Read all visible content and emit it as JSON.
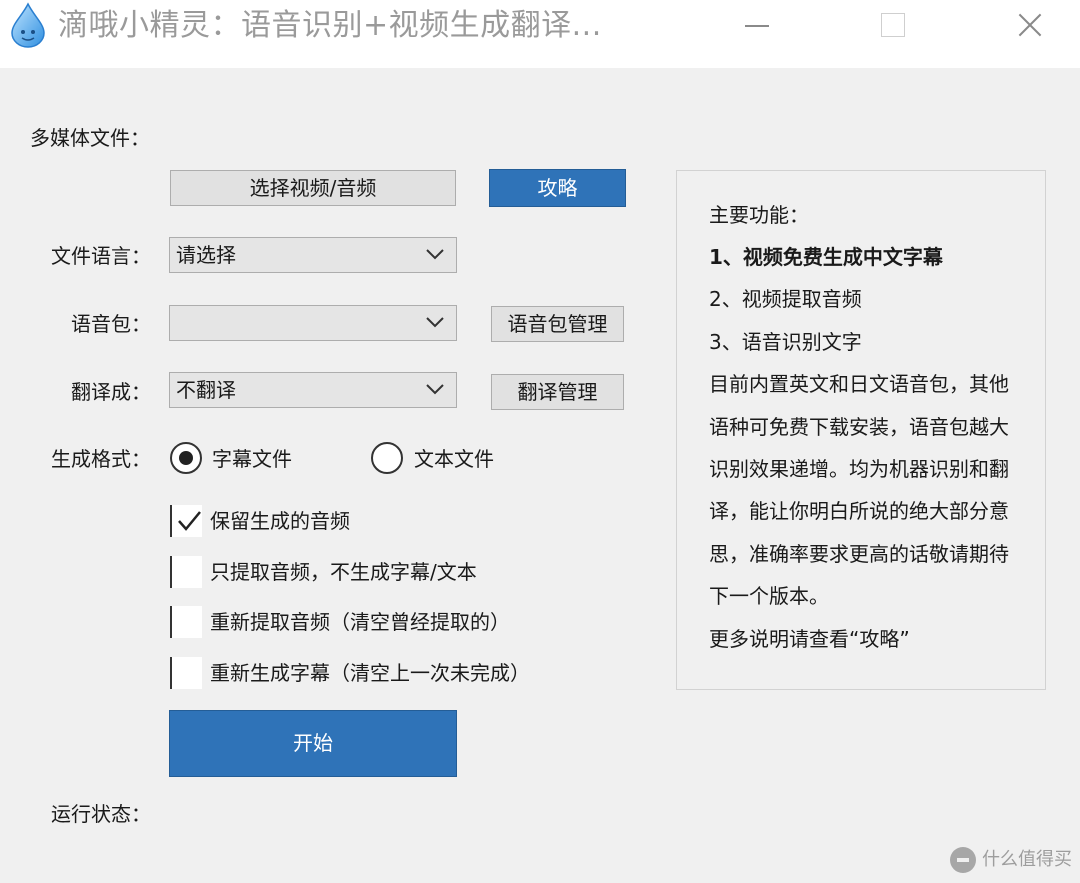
{
  "window": {
    "title": "滴哦小精灵：语音识别+视频生成翻译..."
  },
  "form": {
    "media_label": "多媒体文件：",
    "select_media_button": "选择视频/音频",
    "guide_button": "攻略",
    "file_language_label": "文件语言：",
    "file_language_value": "请选择",
    "voice_pack_label": "语音包：",
    "voice_pack_value": "",
    "voice_pack_manage_button": "语音包管理",
    "translate_label": "翻译成：",
    "translate_value": "不翻译",
    "translate_manage_button": "翻译管理",
    "format_label": "生成格式：",
    "format_options": [
      {
        "label": "字幕文件",
        "selected": true
      },
      {
        "label": "文本文件",
        "selected": false
      }
    ],
    "options": [
      {
        "label": "保留生成的音频",
        "checked": true
      },
      {
        "label": "只提取音频，不生成字幕/文本",
        "checked": false
      },
      {
        "label": "重新提取音频（清空曾经提取的）",
        "checked": false
      },
      {
        "label": "重新生成字幕（清空上一次未完成）",
        "checked": false
      }
    ],
    "start_button": "开始",
    "status_label": "运行状态："
  },
  "info_panel": {
    "lines": [
      "主要功能：",
      "1、视频免费生成中文字幕",
      "2、视频提取音频",
      "3、语音识别文字",
      "目前内置英文和日文语音包，其他",
      "语种可免费下载安装，语音包越大",
      "识别效果递增。均为机器识别和翻",
      "译，能让你明白所说的绝大部分意",
      "思，准确率要求更高的话敬请期待",
      "下一个版本。",
      "更多说明请查看“攻略”"
    ]
  },
  "watermark": {
    "text": "什么值得买"
  },
  "colors": {
    "primary": "#2f73b8",
    "window_bg": "#f0f0f0",
    "titlebar_bg": "#ffffff",
    "title_text": "#9a9a9a"
  },
  "icons": {
    "app": "water-drop-icon",
    "minimize": "minimize-icon",
    "maximize": "maximize-icon",
    "close": "close-icon",
    "dropdown": "chevron-down-icon",
    "check": "checkmark-icon"
  }
}
